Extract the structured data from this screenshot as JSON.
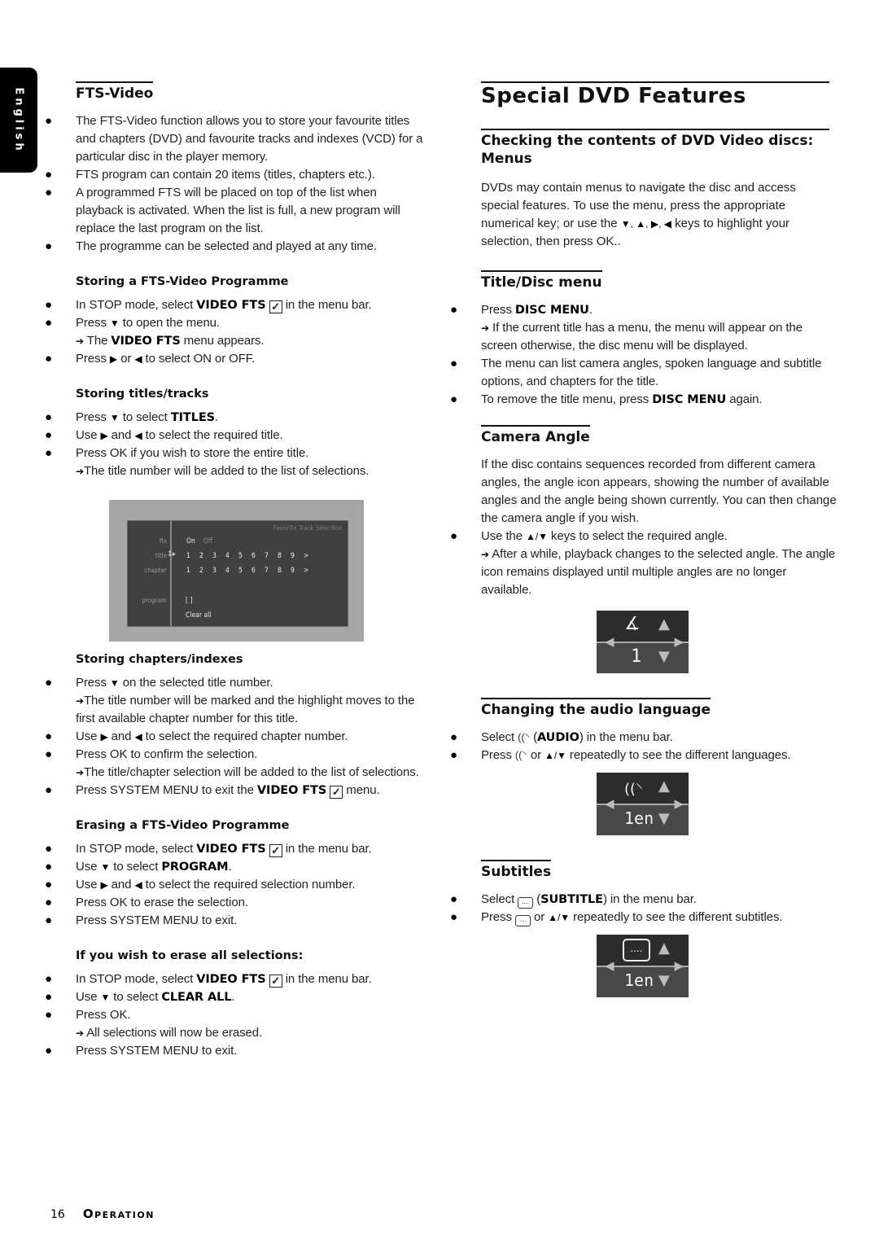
{
  "language_tab": "English",
  "left": {
    "title": "FTS-Video",
    "intro_bullets": [
      "The FTS-Video function allows you to store your favourite titles and chapters (DVD) and favourite tracks and indexes (VCD) for a particular disc in the player memory.",
      "FTS program can contain 20 items (titles, chapters etc.).",
      "A programmed FTS will be placed on top of the list when playback is activated. When the list is full, a new program will replace the last program on the list.",
      "The programme can be selected and played at any time."
    ],
    "storing": {
      "heading": "Storing a FTS-Video Programme",
      "b1_pre": "In STOP mode, select ",
      "b1_kw": "VIDEO FTS",
      "b1_post": " in the menu bar.",
      "b2_pre": "Press ",
      "b2_post": " to open the menu.",
      "b2_result_pre": "The ",
      "b2_result_kw": "VIDEO FTS",
      "b2_result_post": " menu appears.",
      "b3_pre": "Press ",
      "b3_mid": " or ",
      "b3_post": "  to select ON or OFF."
    },
    "titles": {
      "heading": "Storing titles/tracks",
      "b1_pre": "Press ",
      "b1_mid": " to select ",
      "b1_kw": "TITLES",
      "b1_post": ".",
      "b2_pre": "Use ",
      "b2_mid": " and ",
      "b2_post": " to select the required title.",
      "b3": "Press OK if you wish to store the entire title.",
      "b3_result": "The title number will be added to the list of selections."
    },
    "osd_menu": {
      "header": "Favorite Track Selection",
      "rows": {
        "fts_label": "fts",
        "fts_on": "On",
        "fts_off": "Off",
        "title_label": "title",
        "chapter_label": "chapter",
        "program_label": "program",
        "program_value": "[ ]",
        "clear_all": "Clear all"
      },
      "numbers": [
        "1",
        "2",
        "3",
        "4",
        "5",
        "6",
        "7",
        "8",
        "9",
        ">"
      ]
    },
    "chapters": {
      "heading": "Storing chapters/indexes",
      "b1_pre": "Press ",
      "b1_post": " on the selected title number.",
      "b1_result": "The title number will be marked and the highlight moves to the first available chapter number for this title.",
      "b2_pre": "Use ",
      "b2_mid": " and ",
      "b2_post": " to select the required chapter number.",
      "b3": "Press OK to confirm the selection.",
      "b3_result": "The title/chapter selection will be added to the list of selections.",
      "b4_pre": "Press SYSTEM MENU to exit the ",
      "b4_kw": "VIDEO FTS",
      "b4_post": " menu."
    },
    "erasing": {
      "heading": "Erasing a FTS-Video Programme",
      "b1_pre": "In STOP mode, select ",
      "b1_kw": "VIDEO FTS",
      "b1_post": " in the menu bar.",
      "b2_pre": "Use ",
      "b2_mid": " to select ",
      "b2_kw": "PROGRAM",
      "b2_post": ".",
      "b3_pre": "Use ",
      "b3_mid": " and ",
      "b3_post": " to select the required selection number.",
      "b4": "Press OK to erase the selection.",
      "b5": "Press SYSTEM MENU to exit."
    },
    "erase_all": {
      "heading": "If you wish to erase all selections:",
      "b1_pre": "In STOP mode, select ",
      "b1_kw": "VIDEO FTS",
      "b1_post": " in the menu bar.",
      "b2_pre": "Use ",
      "b2_mid": " to select ",
      "b2_kw": "CLEAR ALL",
      "b2_post": ".",
      "b3": "Press OK.",
      "b3_result": "All selections will now be erased.",
      "b4": "Press SYSTEM MENU to exit."
    }
  },
  "right": {
    "title": "Special DVD Features",
    "menus": {
      "heading": "Checking the contents of DVD Video discs: Menus",
      "para_pre": "DVDs may contain menus to navigate the disc and access special features. To use the menu, press the appropriate numerical key; or use the ",
      "para_post": " keys to highlight your selection, then press OK.."
    },
    "title_disc": {
      "heading": "Title/Disc menu",
      "b1_pre": "Press ",
      "b1_kw": "DISC MENU",
      "b1_post": ".",
      "b1_result": "If the current title has a menu, the menu will appear on the screen otherwise, the disc menu will be displayed.",
      "b2": "The menu can list camera angles, spoken language and subtitle options, and chapters for the title.",
      "b3_pre": "To remove the title menu, press ",
      "b3_kw": "DISC MENU",
      "b3_post": " again."
    },
    "camera": {
      "heading": "Camera Angle",
      "para": "If the disc contains sequences recorded from different camera angles, the angle icon appears, showing the number of available angles and the angle being shown currently. You can then change the camera angle if you wish.",
      "b1_pre": "Use the ",
      "b1_post": " keys to select the required angle.",
      "b1_result": "After a while, playback changes to the selected angle. The angle  icon remains displayed until multiple angles are no longer available.",
      "osd_value": "1"
    },
    "audio": {
      "heading": "Changing the audio language",
      "b1_pre": "Select ",
      "b1_kw": "AUDIO",
      "b1_post": ") in the menu bar.",
      "b2_pre": "Press ",
      "b2_mid": " or ",
      "b2_post": " repeatedly to see the different languages.",
      "osd_value": "1en"
    },
    "subtitles": {
      "heading": "Subtitles",
      "b1_pre": "Select ",
      "b1_kw": "SUBTITLE",
      "b1_post": ") in the menu bar.",
      "b2_pre": "Press ",
      "b2_mid": " or ",
      "b2_post": " repeatedly to see the different subtitles.",
      "osd_value": "1en"
    }
  },
  "footer": {
    "page_number": "16",
    "section": "Operation"
  },
  "glyphs": {
    "down": "▼",
    "up": "▲",
    "right": "▶",
    "left": "◀",
    "arrow": "➔",
    "check": "✓",
    "updown": "▲/▼",
    "four_keys": "▼, ▲, ▶, ◀",
    "angle": "∡",
    "audio": "((὞3",
    "subtitle": "....",
    "paren_open": " ("
  }
}
